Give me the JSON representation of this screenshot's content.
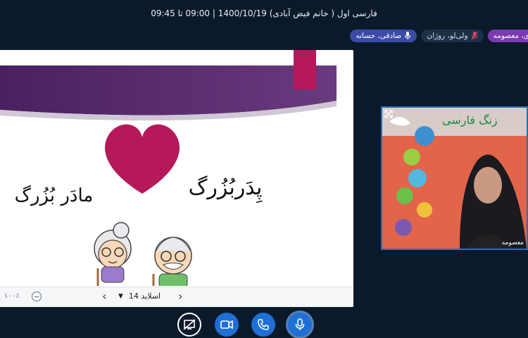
{
  "header": {
    "title": "فارسی اول ( خانم فیض آبادی) 1400/10/19 | 09:00 تا 09:45"
  },
  "participants": [
    {
      "name": "ی، معصومه",
      "status": "talking"
    },
    {
      "name": "ولی‌لو، روژان",
      "status": "muted"
    },
    {
      "name": "صادقی، حسانه",
      "status": "mic"
    }
  ],
  "slide": {
    "word_right": "پِدَربُزُرگ",
    "word_left": "مادَر بُزُرگ"
  },
  "slide_controls": {
    "zoom": "۱۰۰٪",
    "slide_label": "اسلاید 14"
  },
  "video": {
    "name_label": "معصومه",
    "background_text": "زنگ فارسی"
  },
  "colors": {
    "accent": "#1e6fd6",
    "slide_purple": "#5b2a6e",
    "heart": "#b5195a",
    "letter_yellow": "#f4b400"
  }
}
